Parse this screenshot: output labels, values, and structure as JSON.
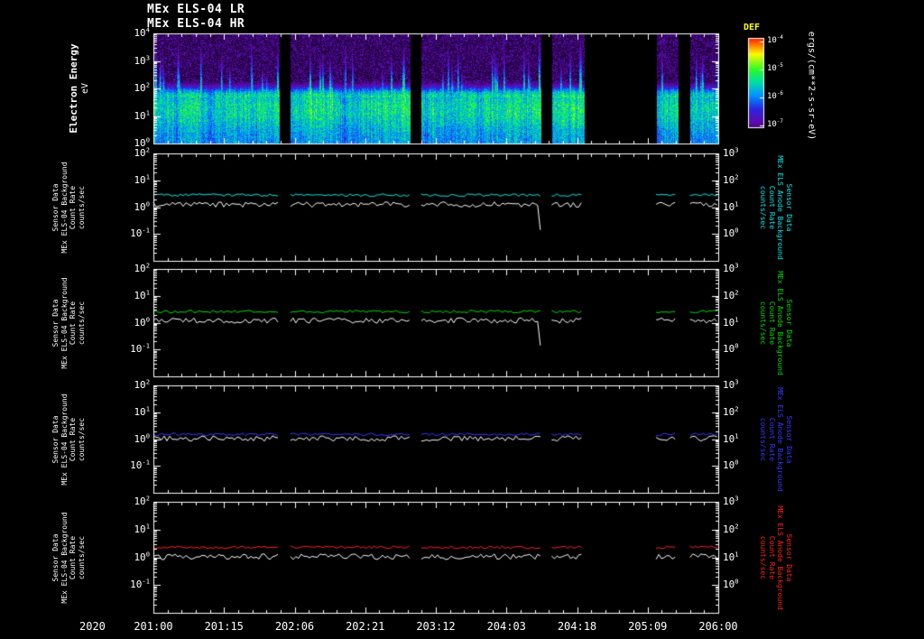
{
  "titles": {
    "lr": "MEx ELS-04 LR",
    "hr": "MEx ELS-04 HR"
  },
  "x_axis": {
    "year": "2020",
    "tick_labels": [
      "201:00",
      "201:15",
      "202:06",
      "202:21",
      "203:12",
      "204:03",
      "204:18",
      "205:09",
      "206:00"
    ]
  },
  "spectrogram": {
    "ylabel": "Electron Energy",
    "yunits": "eV",
    "y_tick_exponents": [
      4,
      3,
      2,
      1,
      0
    ],
    "colorbar_title": "DEF",
    "colorbar_title_color": "#ffff00",
    "colorbar_tick_exponents": [
      -4,
      -5,
      -6,
      -7
    ],
    "colorbar_units": "ergs/(cm**2-s-sr-eV)"
  },
  "line_panels": [
    {
      "id": "cyan",
      "color": "#00e8e8",
      "left_label_lines": [
        "Sensor Data",
        "MEx ELS-04 Background",
        "Count Rate",
        "counts/sec"
      ],
      "right_label_lines": [
        "Sensor Data",
        "MEx ELS Anode Background",
        "Count Rate",
        "counts/sec"
      ],
      "left_tick_exponents": [
        2,
        1,
        0,
        -1
      ],
      "right_tick_exponents": [
        3,
        2,
        1,
        0
      ]
    },
    {
      "id": "green",
      "color": "#00dd00",
      "left_label_lines": [
        "Sensor Data",
        "MEx ELS-04 Background",
        "Count Rate",
        "counts/sec"
      ],
      "right_label_lines": [
        "Sensor Data",
        "MEx ELS Anode Background",
        "Count Rate",
        "counts/sec"
      ],
      "left_tick_exponents": [
        2,
        1,
        0,
        -1
      ],
      "right_tick_exponents": [
        3,
        2,
        1,
        0
      ]
    },
    {
      "id": "blue",
      "color": "#3838ff",
      "left_label_lines": [
        "Sensor Data",
        "MEx ELS-04 Background",
        "Count Rate",
        "counts/sec"
      ],
      "right_label_lines": [
        "Sensor Data",
        "MEx ELS Anode Background",
        "Count Rate",
        "counts/sec"
      ],
      "left_tick_exponents": [
        2,
        1,
        0,
        -1
      ],
      "right_tick_exponents": [
        3,
        2,
        1,
        0
      ]
    },
    {
      "id": "red",
      "color": "#ff2020",
      "left_label_lines": [
        "Sensor Data",
        "MEx ELS-04 Background",
        "Count Rate",
        "counts/sec"
      ],
      "right_label_lines": [
        "Sensor Data",
        "MEx ELS Anode Background",
        "Count Rate",
        "counts/sec"
      ],
      "left_tick_exponents": [
        2,
        1,
        0,
        -1
      ],
      "right_tick_exponents": [
        3,
        2,
        1,
        0
      ]
    }
  ],
  "chart_data": [
    {
      "type": "heatmap",
      "title": "MEx ELS-04 HR electron energy spectrogram",
      "xlabel": "2020 day-of-year:hour (201:00 to 206:00)",
      "ylabel": "Electron Energy (eV)",
      "x_range_hours": [
        0,
        120
      ],
      "x_tick_labels": [
        "201:00",
        "201:15",
        "202:06",
        "202:21",
        "203:12",
        "204:03",
        "204:18",
        "205:09",
        "206:00"
      ],
      "x_major_tick_interval_hours": 15,
      "y_log_range_ev": [
        1,
        10000
      ],
      "z_label": "DEF",
      "z_units": "ergs/(cm**2-s-sr-eV)",
      "z_log_range": [
        1e-07,
        0.0001
      ],
      "data_segments_hours": [
        [
          0,
          26.8
        ],
        [
          29.1,
          54.6
        ],
        [
          56.9,
          82.3
        ],
        [
          84.6,
          91.5
        ],
        [
          106.8,
          111.4
        ],
        [
          114.0,
          120
        ]
      ],
      "main_flux_band_ev": [
        5,
        100
      ],
      "description": "Bright green/yellow differential energy flux band between ~5 and ~100 eV with intermittent vertical enhancements reaching ~1 keV; speckled purple low flux above ~200 eV; black vertical bands are data gaps."
    },
    {
      "type": "line",
      "panel": "cyan",
      "ylabel": "Sensor Data MEx ELS-04 Background Count Rate (counts/sec)",
      "y_log_range": [
        0.01,
        100
      ],
      "end_spike_hour": 82.3,
      "series": [
        {
          "name": "MEx ELS anode background count rate",
          "color": "cyan",
          "approx_level_counts_per_sec": 2.8
        },
        {
          "name": "MEx ELS-04 background count rate",
          "color": "white",
          "approx_level_counts_per_sec": 1.25,
          "features": "sharp downward spike to ~0.15 counts/sec near hour 82"
        }
      ],
      "data_segments_hours": [
        [
          0,
          26.8
        ],
        [
          29.1,
          54.6
        ],
        [
          56.9,
          82.3
        ],
        [
          84.6,
          91.5
        ],
        [
          106.8,
          111.4
        ],
        [
          114.0,
          120
        ]
      ]
    },
    {
      "type": "line",
      "panel": "green",
      "ylabel": "Sensor Data MEx ELS-04 Background Count Rate (counts/sec)",
      "y_log_range": [
        0.01,
        100
      ],
      "end_spike_hour": 82.3,
      "series": [
        {
          "name": "MEx ELS anode background count rate",
          "color": "green",
          "approx_level_counts_per_sec": 2.6
        },
        {
          "name": "MEx ELS-04 background count rate",
          "color": "white",
          "approx_level_counts_per_sec": 1.2,
          "features": "sharp downward spike to ~0.15 counts/sec near hour 82"
        }
      ],
      "data_segments_hours": [
        [
          0,
          26.8
        ],
        [
          29.1,
          54.6
        ],
        [
          56.9,
          82.3
        ],
        [
          84.6,
          91.5
        ],
        [
          106.8,
          111.4
        ],
        [
          114.0,
          120
        ]
      ]
    },
    {
      "type": "line",
      "panel": "blue",
      "ylabel": "Sensor Data MEx ELS-04 Background Count Rate (counts/sec)",
      "y_log_range": [
        0.01,
        100
      ],
      "series": [
        {
          "name": "MEx ELS anode background count rate",
          "color": "blue",
          "approx_level_counts_per_sec": 1.5
        },
        {
          "name": "MEx ELS-04 background count rate",
          "color": "white",
          "approx_level_counts_per_sec": 1.05
        }
      ],
      "data_segments_hours": [
        [
          0,
          26.8
        ],
        [
          29.1,
          54.6
        ],
        [
          56.9,
          82.3
        ],
        [
          84.6,
          91.5
        ],
        [
          106.8,
          111.4
        ],
        [
          114.0,
          120
        ]
      ]
    },
    {
      "type": "line",
      "panel": "red",
      "ylabel": "Sensor Data MEx ELS-04 Background Count Rate (counts/sec)",
      "y_log_range": [
        0.01,
        100
      ],
      "series": [
        {
          "name": "MEx ELS anode background count rate",
          "color": "red",
          "approx_level_counts_per_sec": 2.3
        },
        {
          "name": "MEx ELS-04 background count rate",
          "color": "white",
          "approx_level_counts_per_sec": 1.05
        }
      ],
      "data_segments_hours": [
        [
          0,
          26.8
        ],
        [
          29.1,
          54.6
        ],
        [
          56.9,
          82.3
        ],
        [
          84.6,
          91.5
        ],
        [
          106.8,
          111.4
        ],
        [
          114.0,
          120
        ]
      ]
    }
  ]
}
